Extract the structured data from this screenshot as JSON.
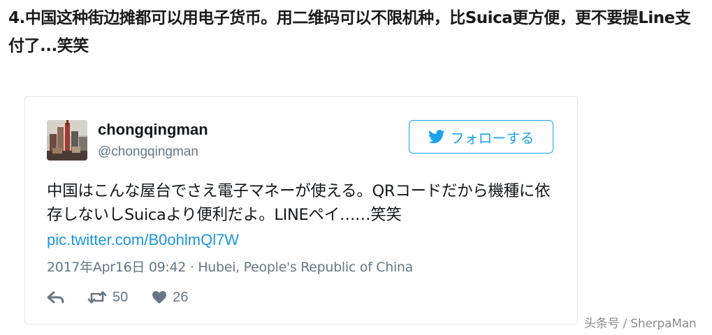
{
  "article": {
    "heading": "4.中国这种街边摊都可以用电子货币。用二维码可以不限机种，比Suica更方便，更不要提Line支付了...笑笑"
  },
  "tweet": {
    "display_name": "chongqingman",
    "screen_name": "@chongqingman",
    "follow_label": "フォローする",
    "text": "中国はこんな屋台でさえ電子マネーが使える。QRコードだから機種に依存しないしSuicaより便利だよ。LINEペイ……笑笑",
    "link": "pic.twitter.com/B0ohlmQl7W",
    "meta": "2017年Apr16日 09:42 · Hubei, People's Republic of China",
    "retweet_count": "50",
    "like_count": "26",
    "icons": {
      "avatar": "avatar-photo",
      "follow": "twitter-bird-icon",
      "reply": "reply-icon",
      "retweet": "retweet-icon",
      "like": "heart-icon"
    },
    "colors": {
      "accent": "#1da1f2",
      "link": "#1b95e0",
      "muted": "#657786",
      "text": "#14171a"
    }
  },
  "watermark": {
    "text": "头条号 / SherpaMan"
  }
}
